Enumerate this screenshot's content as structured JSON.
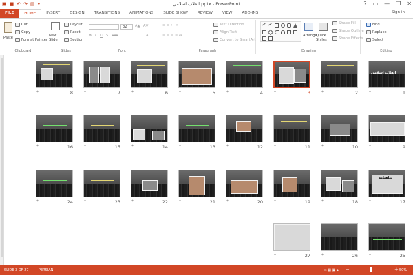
{
  "window": {
    "title": "انقلاب اسلامی.pptx - PowerPoint",
    "help": "?",
    "minimize": "—",
    "restore": "❐",
    "close": "✕"
  },
  "tabs": [
    {
      "label": "FILE"
    },
    {
      "label": "HOME"
    },
    {
      "label": "INSERT"
    },
    {
      "label": "DESIGN"
    },
    {
      "label": "TRANSITIONS"
    },
    {
      "label": "ANIMATIONS"
    },
    {
      "label": "SLIDE SHOW"
    },
    {
      "label": "REVIEW"
    },
    {
      "label": "VIEW"
    },
    {
      "label": "ADD-INS"
    }
  ],
  "signin": "Sign in",
  "ribbon": {
    "clipboard": {
      "label": "Clipboard",
      "paste": "Paste",
      "cut": "Cut",
      "copy": "Copy",
      "format_painter": "Format Painter"
    },
    "slides": {
      "label": "Slides",
      "new_slide": "New Slide",
      "layout": "Layout",
      "reset": "Reset",
      "section": "Section"
    },
    "font": {
      "label": "Font",
      "size": "32"
    },
    "paragraph": {
      "label": "Paragraph",
      "text_direction": "Text Direction",
      "align_text": "Align Text",
      "convert": "Convert to SmartArt"
    },
    "drawing": {
      "label": "Drawing",
      "arrange": "Arrange",
      "quick_styles": "Quick Styles",
      "shape_fill": "Shape Fill",
      "shape_outline": "Shape Outline",
      "shape_effects": "Shape Effects"
    },
    "editing": {
      "label": "Editing",
      "find": "Find",
      "replace": "Replace",
      "select": "Select"
    }
  },
  "slides": [
    {
      "number": "1",
      "star": "*"
    },
    {
      "number": "2",
      "star": "*"
    },
    {
      "number": "3",
      "star": "*"
    },
    {
      "number": "4",
      "star": "*"
    },
    {
      "number": "5",
      "star": "*"
    },
    {
      "number": "6",
      "star": "*"
    },
    {
      "number": "7",
      "star": "*"
    },
    {
      "number": "8",
      "star": "*"
    },
    {
      "number": "9",
      "star": "*"
    },
    {
      "number": "10",
      "star": "*"
    },
    {
      "number": "11",
      "star": "*"
    },
    {
      "number": "12",
      "star": "*"
    },
    {
      "number": "13",
      "star": "*"
    },
    {
      "number": "14",
      "star": "*"
    },
    {
      "number": "15",
      "star": "*"
    },
    {
      "number": "16",
      "star": "*"
    },
    {
      "number": "17",
      "star": "*"
    },
    {
      "number": "18",
      "star": "*"
    },
    {
      "number": "19",
      "star": "*"
    },
    {
      "number": "20",
      "star": "*"
    },
    {
      "number": "21",
      "star": "*"
    },
    {
      "number": "22",
      "star": "*"
    },
    {
      "number": "23",
      "star": "*"
    },
    {
      "number": "24",
      "star": "*"
    },
    {
      "number": "25",
      "star": "*"
    },
    {
      "number": "26",
      "star": "*"
    },
    {
      "number": "27",
      "star": "*"
    }
  ],
  "selected_slide": 3,
  "slide1_title": "انقلاب اسلامی",
  "slide17_title": "شاهنامه",
  "status": {
    "slide_info": "SLIDE 3 OF 27",
    "language": "PERSIAN",
    "zoom": "50%",
    "zoom_minus": "−",
    "zoom_plus": "+"
  },
  "colors": {
    "accent": "#d24726"
  }
}
